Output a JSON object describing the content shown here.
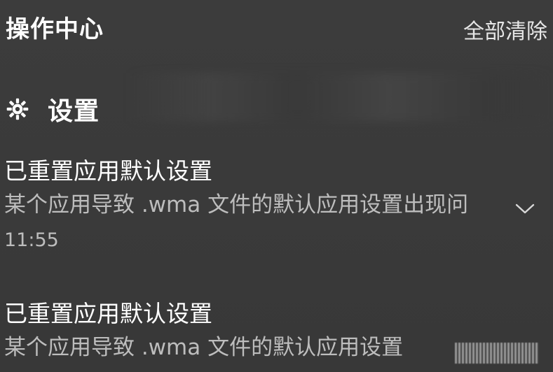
{
  "header": {
    "title": "操作中心",
    "clear_all_label": "全部清除"
  },
  "group": {
    "icon": "gear-icon",
    "title": "设置"
  },
  "notifications": [
    {
      "title": "已重置应用默认设置",
      "body": "某个应用导致 .wma 文件的默认应用设置出现问",
      "time": "11:55",
      "expand_icon": "chevron-down-icon"
    },
    {
      "title": "已重置应用默认设置",
      "body": "某个应用导致 .wma 文件的默认应用设置"
    }
  ],
  "colors": {
    "background": "#3a3a3a",
    "text_primary": "#ffffff",
    "text_secondary": "#bdbdbd"
  }
}
